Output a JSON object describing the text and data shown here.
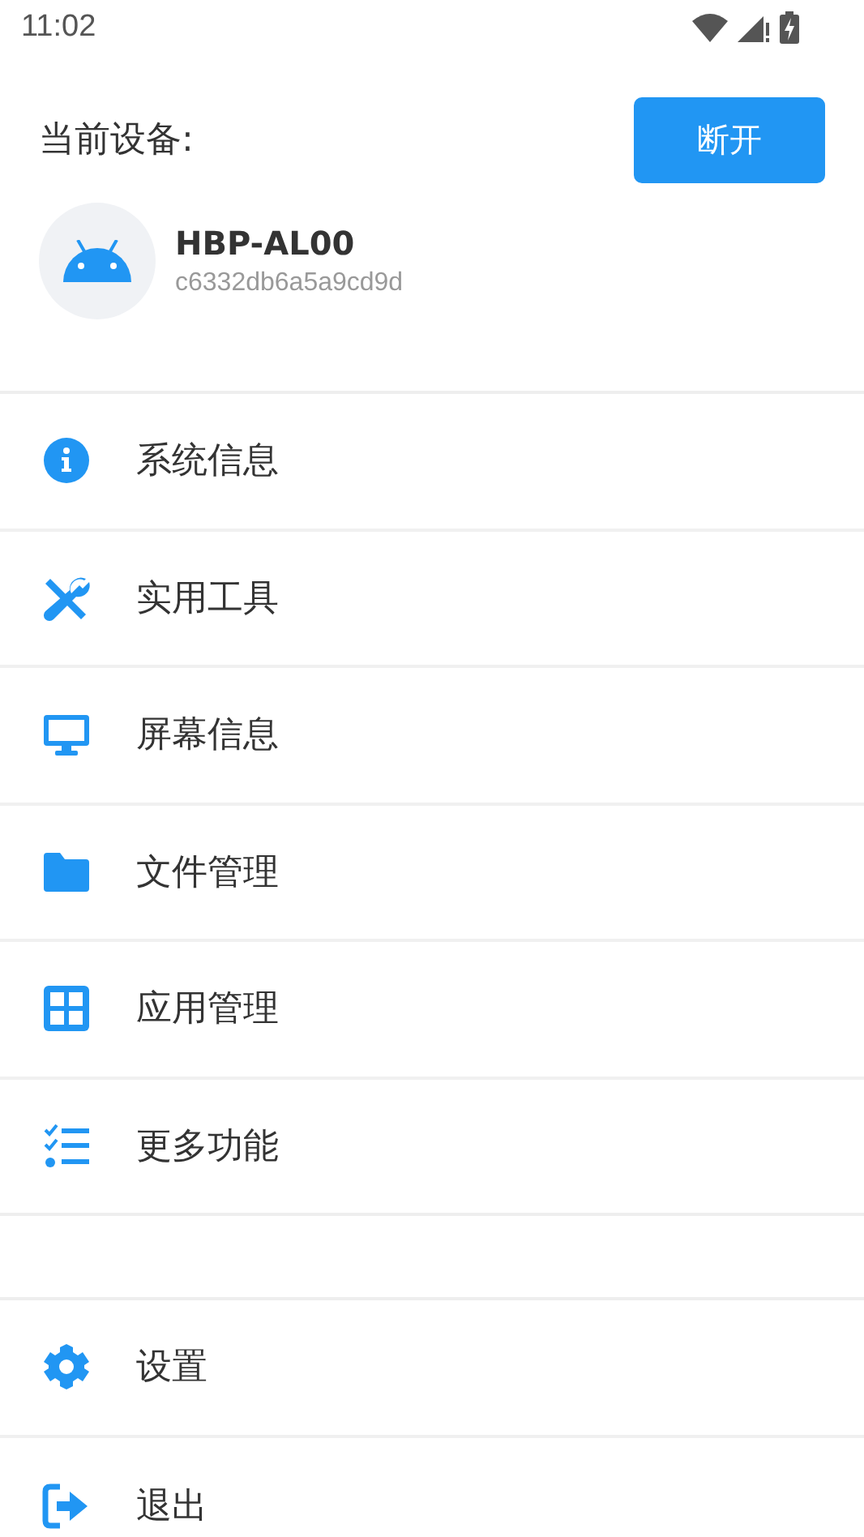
{
  "status_bar": {
    "time": "11:02"
  },
  "device": {
    "label": "当前设备:",
    "button": "断开",
    "name": "HBP-AL00",
    "serial": "c6332db6a5a9cd9d"
  },
  "menu": [
    {
      "kind": "info",
      "label": "系统信息"
    },
    {
      "kind": "tools",
      "label": "实用工具"
    },
    {
      "kind": "screen",
      "label": "屏幕信息"
    },
    {
      "kind": "folder",
      "label": "文件管理"
    },
    {
      "kind": "apps",
      "label": "应用管理"
    },
    {
      "kind": "list",
      "label": "更多功能"
    }
  ],
  "bottom_menu": [
    {
      "kind": "settings",
      "label": "设置"
    },
    {
      "kind": "exit",
      "label": "退出"
    }
  ]
}
